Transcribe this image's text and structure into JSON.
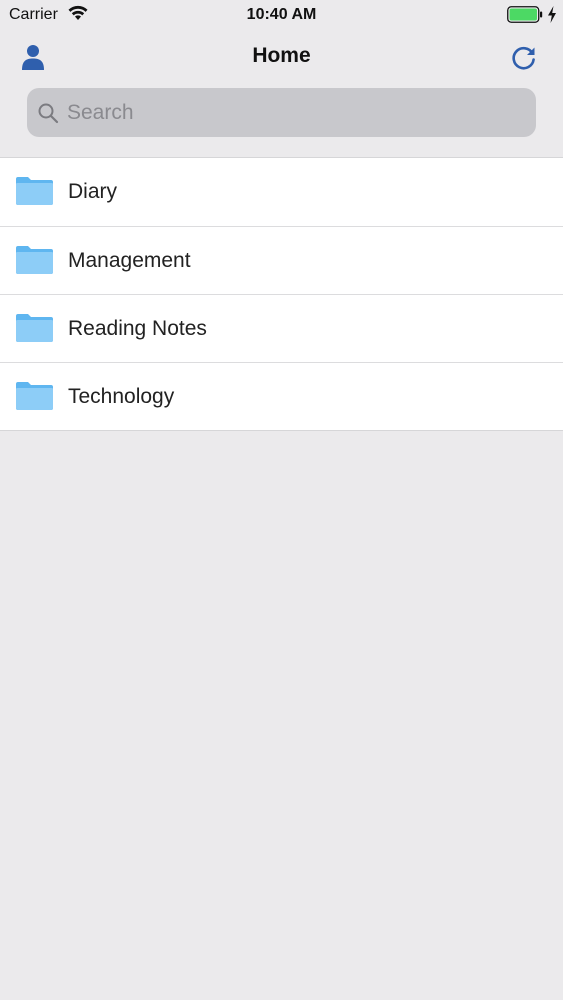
{
  "status_bar": {
    "carrier": "Carrier",
    "time": "10:40 AM",
    "battery_color": "#4cd964"
  },
  "nav": {
    "title": "Home",
    "accent_color": "#2f5fad",
    "left_icon": "person-icon",
    "right_icon": "refresh-icon"
  },
  "search": {
    "placeholder": "Search",
    "value": ""
  },
  "folders": [
    {
      "label": "Diary",
      "icon": "folder-icon"
    },
    {
      "label": "Management",
      "icon": "folder-icon"
    },
    {
      "label": "Reading Notes",
      "icon": "folder-icon"
    },
    {
      "label": "Technology",
      "icon": "folder-icon"
    }
  ]
}
